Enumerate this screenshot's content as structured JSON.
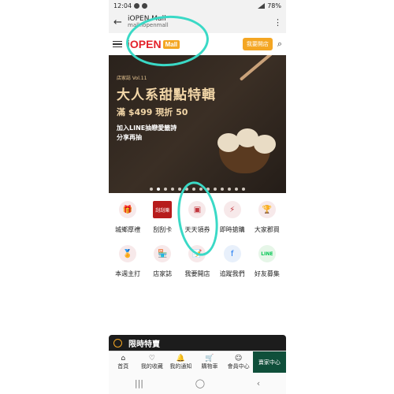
{
  "status_bar": {
    "time": "12:04",
    "battery": "78%"
  },
  "browser": {
    "title": "iOPEN Mall",
    "domain": "mall.iopenmall",
    "back_icon": "arrow-left-icon",
    "more_icon": "more-vertical-icon"
  },
  "header": {
    "brand": "iOPEN",
    "brand_suffix": "Mall",
    "open_shop_button": "我要開店",
    "search_icon": "search-icon"
  },
  "banner": {
    "issue": "店家誌 Vol.11",
    "headline": "大人系甜點特輯",
    "price_line": "滿 $499 現折 50",
    "line1": "加入LINE抽戀愛籤詩",
    "line2": "分享再抽",
    "slide_count": 14,
    "active_slide": 1
  },
  "shortcuts": [
    {
      "label": "城鄉厚禮",
      "icon": "gift-icon",
      "icon_glyph": "🎁"
    },
    {
      "label": "刮刮卡",
      "icon": "scratch-card-icon",
      "icon_glyph": "刮刮樂"
    },
    {
      "label": "天天領券",
      "icon": "coupon-icon",
      "icon_glyph": "▣"
    },
    {
      "label": "即時搶購",
      "icon": "lightning-icon",
      "icon_glyph": "⚡"
    },
    {
      "label": "大家郡買",
      "icon": "trophy-icon",
      "icon_glyph": "🏆"
    },
    {
      "label": "本週主打",
      "icon": "medal-icon",
      "icon_glyph": "🏅"
    },
    {
      "label": "店家誌",
      "icon": "store-icon",
      "icon_glyph": "🏪"
    },
    {
      "label": "我要開店",
      "icon": "document-icon",
      "icon_glyph": "📝"
    },
    {
      "label": "追蹤我們",
      "icon": "facebook-icon",
      "icon_glyph": "f"
    },
    {
      "label": "好友募集",
      "icon": "line-icon",
      "icon_glyph": "LINE"
    }
  ],
  "flash_sale": {
    "title": "限時特賣"
  },
  "bottom_nav": [
    {
      "label": "首頁",
      "icon": "home-icon",
      "glyph": "⌂"
    },
    {
      "label": "我的收藏",
      "icon": "heart-icon",
      "glyph": "♡"
    },
    {
      "label": "我的通知",
      "icon": "bell-icon",
      "glyph": "🔔"
    },
    {
      "label": "購物車",
      "icon": "cart-icon",
      "glyph": "🛒"
    },
    {
      "label": "會員中心",
      "icon": "user-icon",
      "glyph": "☺"
    },
    {
      "label": "賣家中心",
      "icon": "",
      "glyph": ""
    }
  ],
  "colors": {
    "brand_red": "#e3222b",
    "accent_orange": "#f4a623",
    "annotation_teal": "#3ad9c6",
    "seller_green": "#0f4f3a"
  }
}
